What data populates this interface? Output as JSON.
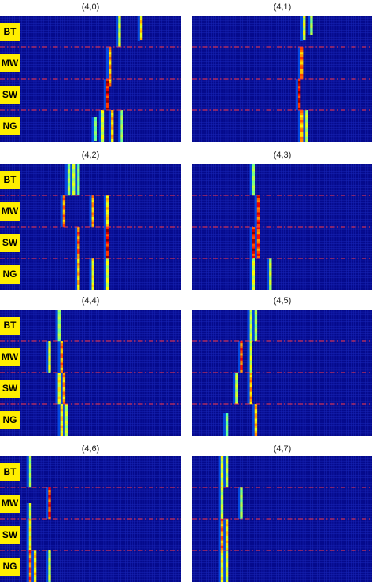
{
  "row_labels": [
    "BT",
    "MW",
    "SW",
    "NG"
  ],
  "colors": {
    "background": "#050a8c",
    "grid": "#1a27b8",
    "separator": "#ff3a4a",
    "badge": "#ffee00"
  },
  "panels": [
    {
      "title": "(4,0)",
      "show_labels": true,
      "streaks": [
        {
          "col": 49,
          "rows": [
            0,
            1
          ],
          "level": 0.45
        },
        {
          "col": 58,
          "rows": [
            0,
            0.8
          ],
          "level": 0.6
        },
        {
          "col": 45,
          "rows": [
            1,
            2.2
          ],
          "level": 0.7
        },
        {
          "col": 44,
          "rows": [
            2,
            3
          ],
          "level": 1.0
        },
        {
          "col": 42,
          "rows": [
            3,
            4
          ],
          "level": 0.5
        },
        {
          "col": 46,
          "rows": [
            3,
            4
          ],
          "level": 0.65
        },
        {
          "col": 50,
          "rows": [
            3,
            4
          ],
          "level": 0.4
        },
        {
          "col": 39,
          "rows": [
            3.2,
            4
          ],
          "level": 0.35
        }
      ]
    },
    {
      "title": "(4,1)",
      "show_labels": false,
      "streaks": [
        {
          "col": 46,
          "rows": [
            0,
            0.8
          ],
          "level": 0.5
        },
        {
          "col": 49,
          "rows": [
            0,
            0.6
          ],
          "level": 0.4
        },
        {
          "col": 45,
          "rows": [
            1,
            2
          ],
          "level": 0.75
        },
        {
          "col": 44,
          "rows": [
            2,
            3
          ],
          "level": 1.0
        },
        {
          "col": 45,
          "rows": [
            3,
            4
          ],
          "level": 0.7
        },
        {
          "col": 47,
          "rows": [
            3,
            4
          ],
          "level": 0.45
        }
      ]
    },
    {
      "title": "(4,2)",
      "show_labels": true,
      "streaks": [
        {
          "col": 28,
          "rows": [
            0,
            1
          ],
          "level": 0.4
        },
        {
          "col": 30,
          "rows": [
            0,
            1
          ],
          "level": 0.45
        },
        {
          "col": 32,
          "rows": [
            0,
            1
          ],
          "level": 0.35
        },
        {
          "col": 26,
          "rows": [
            1,
            2
          ],
          "level": 0.75
        },
        {
          "col": 38,
          "rows": [
            1,
            2
          ],
          "level": 0.7
        },
        {
          "col": 44,
          "rows": [
            1,
            2
          ],
          "level": 0.6
        },
        {
          "col": 32,
          "rows": [
            2,
            3
          ],
          "level": 0.8
        },
        {
          "col": 44,
          "rows": [
            2,
            3
          ],
          "level": 1.0
        },
        {
          "col": 32,
          "rows": [
            3,
            4
          ],
          "level": 0.65
        },
        {
          "col": 38,
          "rows": [
            3,
            4
          ],
          "level": 0.55
        },
        {
          "col": 44,
          "rows": [
            3,
            4
          ],
          "level": 0.5
        }
      ]
    },
    {
      "title": "(4,3)",
      "show_labels": false,
      "streaks": [
        {
          "col": 25,
          "rows": [
            0,
            1
          ],
          "level": 0.4
        },
        {
          "col": 27,
          "rows": [
            1,
            2
          ],
          "level": 0.9
        },
        {
          "col": 25,
          "rows": [
            2,
            3
          ],
          "level": 1.0
        },
        {
          "col": 27,
          "rows": [
            2,
            3
          ],
          "level": 0.85
        },
        {
          "col": 25,
          "rows": [
            3,
            4
          ],
          "level": 0.5
        },
        {
          "col": 32,
          "rows": [
            3,
            4
          ],
          "level": 0.45
        }
      ]
    },
    {
      "title": "(4,4)",
      "show_labels": true,
      "streaks": [
        {
          "col": 24,
          "rows": [
            0,
            1
          ],
          "level": 0.4
        },
        {
          "col": 20,
          "rows": [
            1,
            2
          ],
          "level": 0.5
        },
        {
          "col": 25,
          "rows": [
            1,
            2
          ],
          "level": 0.75
        },
        {
          "col": 26,
          "rows": [
            2,
            3
          ],
          "level": 0.7
        },
        {
          "col": 24,
          "rows": [
            2,
            3
          ],
          "level": 0.55
        },
        {
          "col": 25,
          "rows": [
            3,
            4
          ],
          "level": 0.6
        },
        {
          "col": 27,
          "rows": [
            3,
            4
          ],
          "level": 0.45
        }
      ]
    },
    {
      "title": "(4,5)",
      "show_labels": false,
      "streaks": [
        {
          "col": 24,
          "rows": [
            0,
            1
          ],
          "level": 0.45
        },
        {
          "col": 26,
          "rows": [
            0,
            1
          ],
          "level": 0.4
        },
        {
          "col": 20,
          "rows": [
            1,
            2
          ],
          "level": 0.85
        },
        {
          "col": 24,
          "rows": [
            1,
            2
          ],
          "level": 0.5
        },
        {
          "col": 24,
          "rows": [
            2,
            3
          ],
          "level": 0.7
        },
        {
          "col": 18,
          "rows": [
            2,
            3
          ],
          "level": 0.45
        },
        {
          "col": 26,
          "rows": [
            3,
            4
          ],
          "level": 0.65
        },
        {
          "col": 14,
          "rows": [
            3.3,
            4
          ],
          "level": 0.35
        }
      ]
    },
    {
      "title": "(4,6)",
      "show_labels": true,
      "streaks": [
        {
          "col": 12,
          "rows": [
            0,
            1
          ],
          "level": 0.4
        },
        {
          "col": 20,
          "rows": [
            1,
            2
          ],
          "level": 0.9
        },
        {
          "col": 12,
          "rows": [
            1.5,
            3
          ],
          "level": 0.45
        },
        {
          "col": 12,
          "rows": [
            2,
            3
          ],
          "level": 0.55
        },
        {
          "col": 12,
          "rows": [
            3,
            4
          ],
          "level": 0.8
        },
        {
          "col": 14,
          "rows": [
            3,
            4
          ],
          "level": 0.6
        },
        {
          "col": 20,
          "rows": [
            3,
            4
          ],
          "level": 0.45
        }
      ]
    },
    {
      "title": "(4,7)",
      "show_labels": false,
      "streaks": [
        {
          "col": 12,
          "rows": [
            0,
            1
          ],
          "level": 0.5
        },
        {
          "col": 14,
          "rows": [
            0,
            1
          ],
          "level": 0.45
        },
        {
          "col": 20,
          "rows": [
            1,
            2
          ],
          "level": 0.4
        },
        {
          "col": 12,
          "rows": [
            1,
            2
          ],
          "level": 0.45
        },
        {
          "col": 12,
          "rows": [
            2,
            3
          ],
          "level": 0.75
        },
        {
          "col": 14,
          "rows": [
            2,
            3
          ],
          "level": 0.6
        },
        {
          "col": 12,
          "rows": [
            3,
            4
          ],
          "level": 0.55
        },
        {
          "col": 14,
          "rows": [
            3,
            4
          ],
          "level": 0.5
        }
      ]
    }
  ]
}
